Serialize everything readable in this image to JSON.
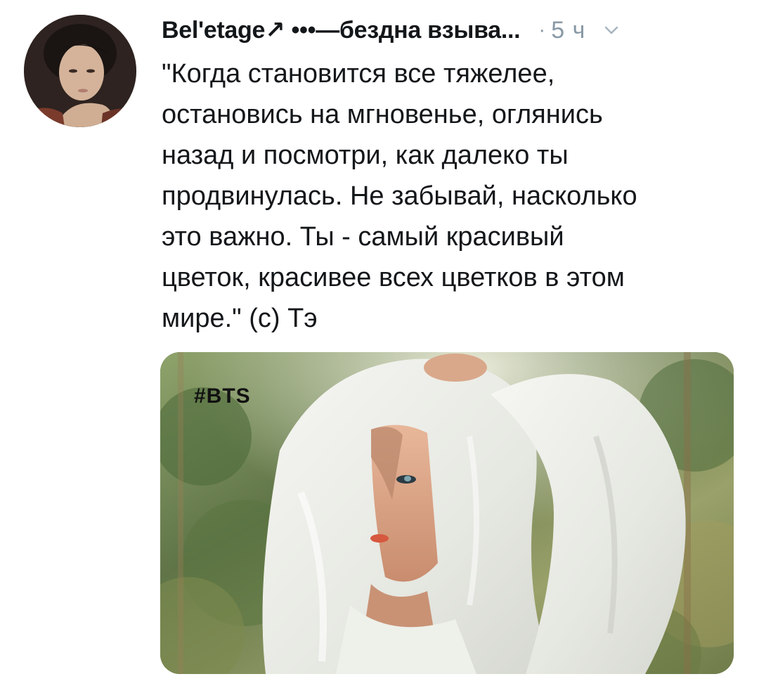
{
  "tweet": {
    "display_name": "Bel'etage↗ •••—бездна взыва...",
    "separator": "·",
    "timestamp": "5 ч",
    "text": "\"Когда становится все тяжелее,\nостановись на мгновенье, оглянись\nназад и посмотри, как далеко ты\nпродвинулась. Не забывай, насколько\nэто важно. Ты - самый красивый\nцветок, красивее всех цветков в этом\nмире.\" (с) Тэ",
    "media": {
      "overlay_text": "#BTS"
    }
  },
  "icons": {
    "menu": "chevron-down-icon"
  },
  "colors": {
    "text_primary": "#14171a",
    "text_secondary": "#8899a6",
    "background": "#ffffff"
  }
}
